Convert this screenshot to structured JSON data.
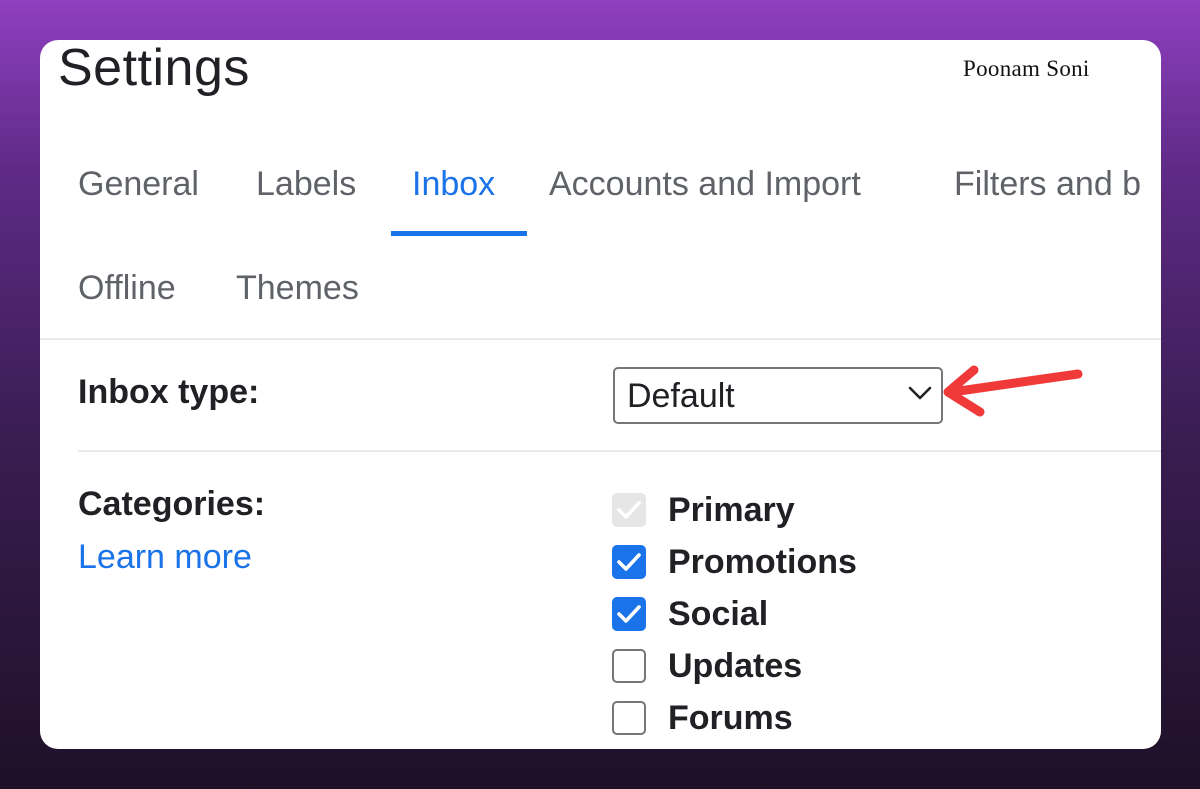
{
  "header": {
    "title": "Settings",
    "watermark": "Poonam Soni"
  },
  "tabs": [
    {
      "label": "General",
      "active": false
    },
    {
      "label": "Labels",
      "active": false
    },
    {
      "label": "Inbox",
      "active": true
    },
    {
      "label": "Accounts and Import",
      "active": false
    },
    {
      "label": "Filters and b",
      "active": false
    },
    {
      "label": "Offline",
      "active": false
    },
    {
      "label": "Themes",
      "active": false
    }
  ],
  "inbox_type": {
    "label": "Inbox type:",
    "selected": "Default"
  },
  "categories": {
    "label": "Categories:",
    "learn_more": "Learn more",
    "items": [
      {
        "label": "Primary",
        "checked": true,
        "disabled": true
      },
      {
        "label": "Promotions",
        "checked": true,
        "disabled": false
      },
      {
        "label": "Social",
        "checked": true,
        "disabled": false
      },
      {
        "label": "Updates",
        "checked": false,
        "disabled": false
      },
      {
        "label": "Forums",
        "checked": false,
        "disabled": false
      }
    ]
  },
  "colors": {
    "accent": "#1a73e8",
    "annotation_arrow": "#f03a3a",
    "text": "#202124",
    "tab_text": "#5f6368"
  },
  "icons": {
    "dropdown": "chevron-down-icon",
    "annotation": "red-arrow-icon",
    "check": "check-icon"
  }
}
